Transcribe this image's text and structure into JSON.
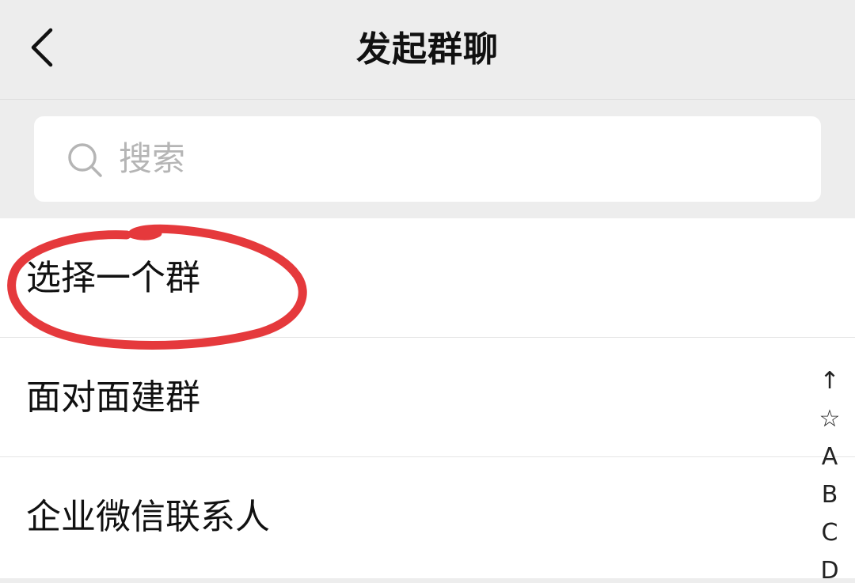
{
  "nav": {
    "title": "发起群聊",
    "back_icon": "chevron-left-icon"
  },
  "search": {
    "placeholder": "搜索",
    "icon": "search-icon"
  },
  "list": {
    "items": [
      {
        "label": "选择一个群"
      },
      {
        "label": "面对面建群"
      },
      {
        "label": "企业微信联系人"
      }
    ]
  },
  "index_bar": {
    "items": [
      "↑",
      "☆",
      "A",
      "B",
      "C",
      "D"
    ]
  },
  "colors": {
    "background": "#ededed",
    "surface": "#ffffff",
    "text": "#111111",
    "placeholder": "#b5b5b5",
    "annotation": "#e5393c"
  }
}
